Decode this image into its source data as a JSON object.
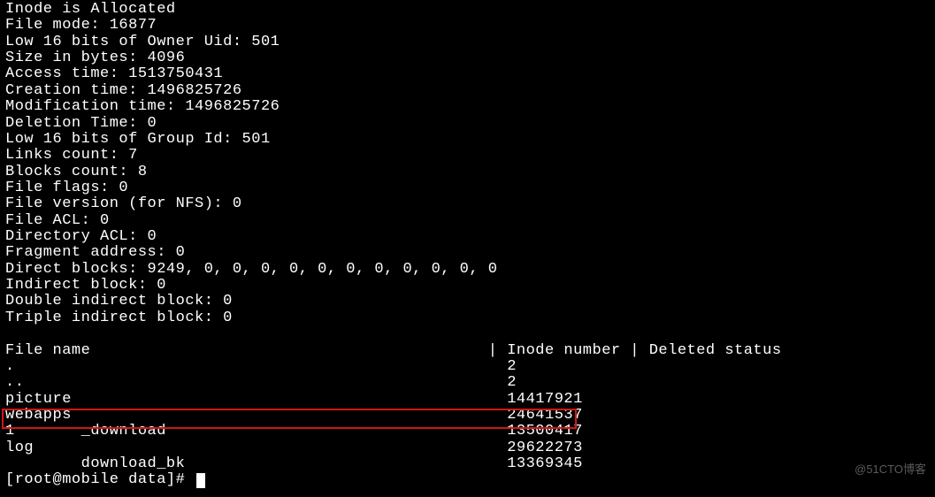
{
  "inode_info": {
    "alloc": "Inode is Allocated",
    "file_mode": "File mode: 16877",
    "owner_uid": "Low 16 bits of Owner Uid: 501",
    "size": "Size in bytes: 4096",
    "access_time": "Access time: 1513750431",
    "creation_time": "Creation time: 1496825726",
    "modification_time": "Modification time: 1496825726",
    "deletion_time": "Deletion Time: 0",
    "group_id": "Low 16 bits of Group Id: 501",
    "links_count": "Links count: 7",
    "blocks_count": "Blocks count: 8",
    "file_flags": "File flags: 0",
    "file_version": "File version (for NFS): 0",
    "file_acl": "File ACL: 0",
    "directory_acl": "Directory ACL: 0",
    "fragment_addr": "Fragment address: 0",
    "direct_blocks": "Direct blocks: 9249, 0, 0, 0, 0, 0, 0, 0, 0, 0, 0, 0",
    "indirect_block": "Indirect block: 0",
    "double_indirect": "Double indirect block: 0",
    "triple_indirect": "Triple indirect block: 0"
  },
  "table": {
    "header": "File name                                          | Inode number | Deleted status",
    "rows": [
      {
        "name": ".",
        "inode": "2"
      },
      {
        "name": "..",
        "inode": "2"
      },
      {
        "name": "picture",
        "inode": "14417921"
      },
      {
        "name": "webapps",
        "inode": "24641537"
      },
      {
        "name": "1       _download",
        "inode": "13500417"
      },
      {
        "name": "log",
        "inode": "29622273"
      },
      {
        "name": "        download_bk",
        "inode": "13369345"
      }
    ]
  },
  "prompt": "[root@mobile data]# ",
  "watermark": "@51CTO博客"
}
